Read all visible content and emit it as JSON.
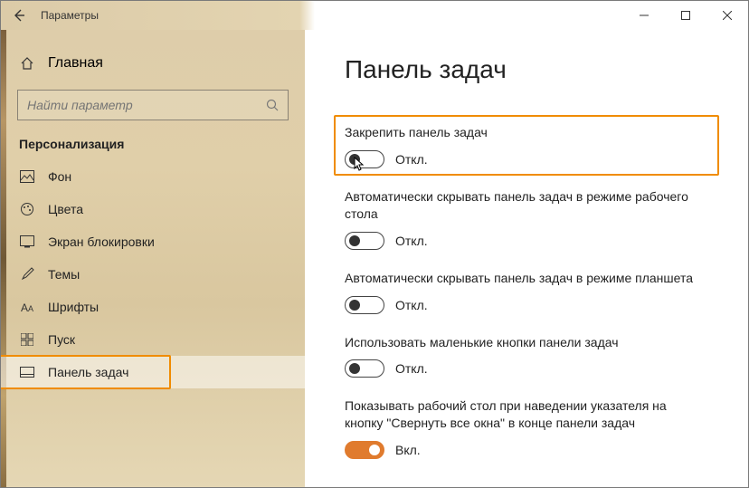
{
  "titlebar": {
    "title": "Параметры"
  },
  "sidebar": {
    "home": "Главная",
    "search_placeholder": "Найти параметр",
    "section": "Персонализация",
    "items": [
      {
        "label": "Фон"
      },
      {
        "label": "Цвета"
      },
      {
        "label": "Экран блокировки"
      },
      {
        "label": "Темы"
      },
      {
        "label": "Шрифты"
      },
      {
        "label": "Пуск"
      },
      {
        "label": "Панель задач"
      }
    ]
  },
  "main": {
    "heading": "Панель задач",
    "settings": [
      {
        "label": "Закрепить панель задач",
        "state": "Откл.",
        "on": false,
        "highlight": true
      },
      {
        "label": "Автоматически скрывать панель задач в режиме рабочего стола",
        "state": "Откл.",
        "on": false
      },
      {
        "label": "Автоматически скрывать панель задач в режиме планшета",
        "state": "Откл.",
        "on": false
      },
      {
        "label": "Использовать маленькие кнопки панели задач",
        "state": "Откл.",
        "on": false
      },
      {
        "label": "Показывать рабочий стол при наведении указателя на кнопку \"Свернуть все окна\" в конце панели задач",
        "state": "Вкл.",
        "on": true
      }
    ]
  }
}
